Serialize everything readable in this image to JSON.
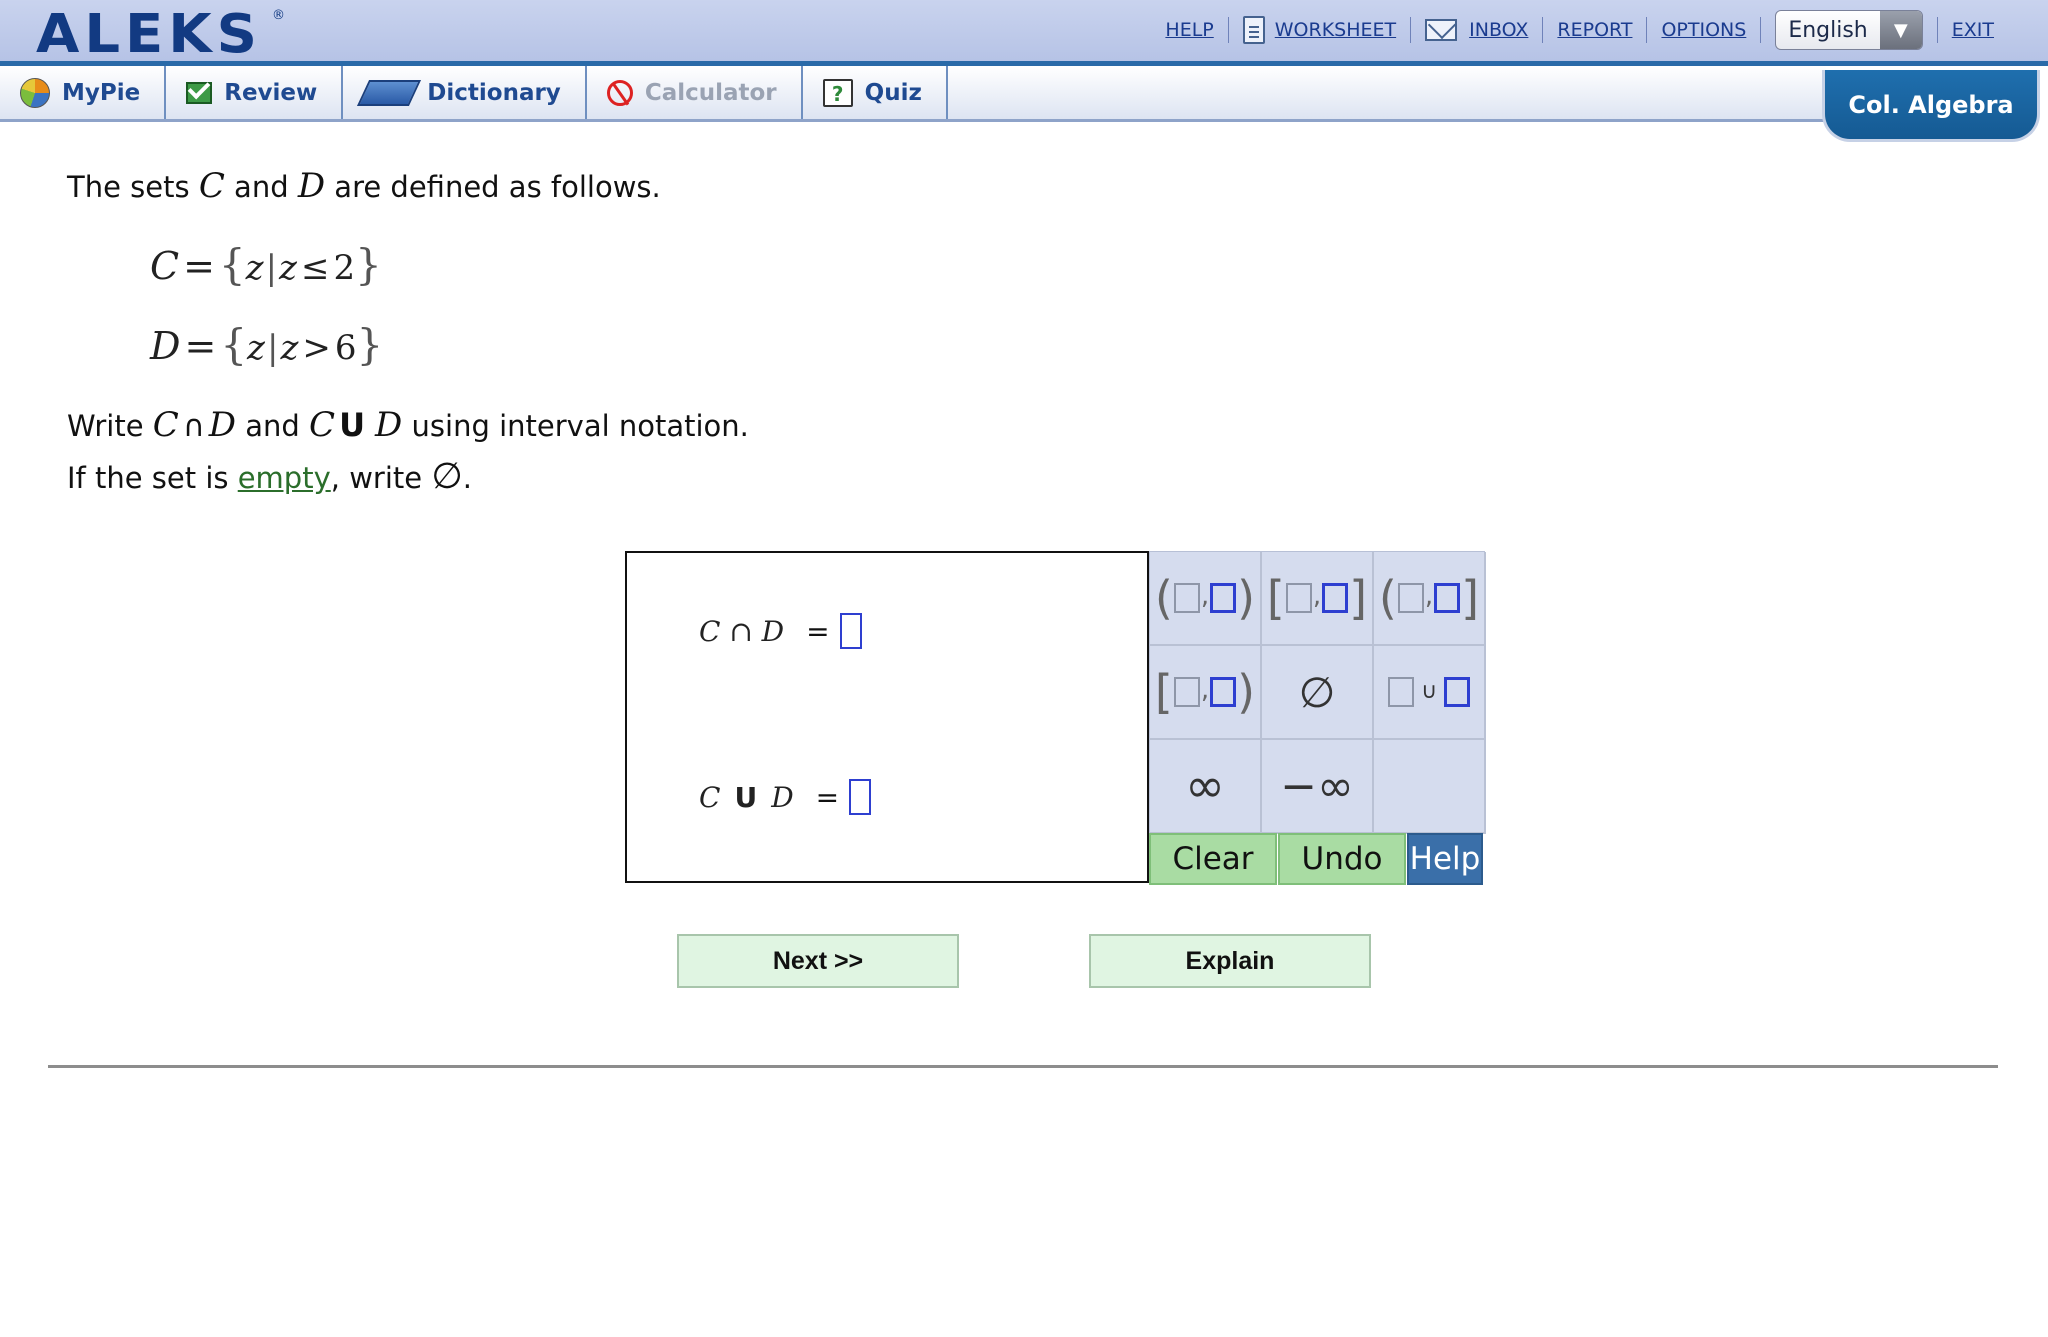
{
  "header": {
    "logo": "ALEKS",
    "logo_mark": "®",
    "links": {
      "help": "HELP",
      "worksheet": "WORKSHEET",
      "inbox": "INBOX",
      "report": "REPORT",
      "options": "OPTIONS",
      "exit": "EXIT"
    },
    "language": "English"
  },
  "tabs": [
    {
      "label": "MyPie",
      "icon": "pie-icon"
    },
    {
      "label": "Review",
      "icon": "review-check-icon"
    },
    {
      "label": "Dictionary",
      "icon": "book-icon"
    },
    {
      "label": "Calculator",
      "icon": "calculator-disabled-icon",
      "disabled": true
    },
    {
      "label": "Quiz",
      "icon": "quiz-icon"
    }
  ],
  "course": "Col. Algebra",
  "question": {
    "intro": {
      "a": "The sets ",
      "v1": "C",
      "b": " and ",
      "v2": "D",
      "c": " are defined as follows."
    },
    "set_c": {
      "name": "C",
      "eq": "=",
      "lb": "{",
      "var": "z",
      "bar": "|",
      "var2": "z",
      "op": "≤",
      "num": "2",
      "rb": "}"
    },
    "set_d": {
      "name": "D",
      "eq": "=",
      "lb": "{",
      "var": "z",
      "bar": "|",
      "var2": "z",
      "op": ">",
      "num": "6",
      "rb": "}"
    },
    "instr": {
      "a": "Write ",
      "v1": "C",
      "op1": "∩",
      "v2": "D",
      "b": " and ",
      "v3": "C",
      "op2": "U",
      "v4": "D",
      "c": " using interval notation."
    },
    "empty": {
      "a": "If the set is ",
      "link": "empty",
      "b": ", write ",
      "sym": "∅",
      "c": "."
    }
  },
  "answer": {
    "row1": {
      "lhs": "C ∩ D",
      "eq": "="
    },
    "row2_left": "C",
    "row2_op": "U",
    "row2_right": "D",
    "row2_eq": "="
  },
  "palette": {
    "open_open": {
      "l": "(",
      "c": ",",
      "r": ")"
    },
    "closed_closed": {
      "l": "[",
      "c": ",",
      "r": "]"
    },
    "open_closed": {
      "l": "(",
      "c": ",",
      "r": "]"
    },
    "closed_open": {
      "l": "[",
      "c": ",",
      "r": ")"
    },
    "empty_set": "∅",
    "union": "∪",
    "infinity": "∞",
    "neg_infinity": "−∞"
  },
  "palette_buttons": {
    "clear": "Clear",
    "undo": "Undo",
    "help": "Help"
  },
  "nav": {
    "next": "Next >>",
    "explain": "Explain"
  },
  "colors": {
    "accent": "#2a6aa8",
    "course_bg": "#1f6fae",
    "slot_border": "#2e3fd0",
    "tool_green": "#a9dca3",
    "help_blue": "#3a6fa9"
  }
}
